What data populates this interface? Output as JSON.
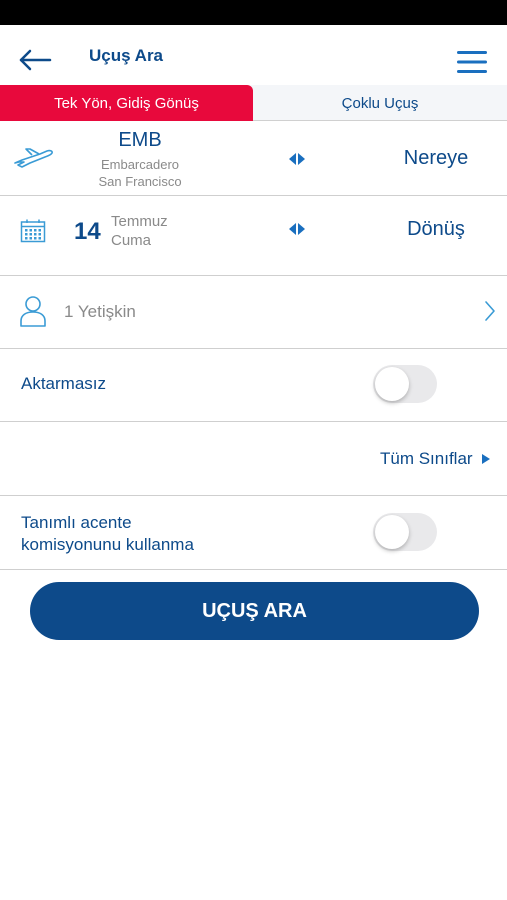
{
  "header": {
    "title": "Uçuş Ara",
    "back_icon": "arrow-left-icon",
    "menu_icon": "hamburger-menu-icon"
  },
  "tabs": [
    {
      "label": "Tek Yön, Gidiş Gönüş",
      "active": true
    },
    {
      "label": "Çoklu Uçuş",
      "active": false
    }
  ],
  "route": {
    "origin_code": "EMB",
    "origin_name": "Embarcadero",
    "origin_city": "San Francisco",
    "destination_label": "Nereye"
  },
  "date": {
    "day": "14",
    "month": "Temmuz",
    "weekday": "Cuma",
    "return_label": "Dönüş"
  },
  "passengers": {
    "label": "1 Yetişkin"
  },
  "direct": {
    "label": "Aktarmasız",
    "enabled": false
  },
  "cabin": {
    "label": "Tüm Sınıflar"
  },
  "commission": {
    "label_line1": "Tanımlı acente",
    "label_line2": "komisyonunu kullanma",
    "enabled": false
  },
  "search_button": {
    "label": "UÇUŞ ARA"
  },
  "colors": {
    "primary": "#0d4a8a",
    "accent": "#e8093c",
    "icon": "#3a9bd5",
    "muted_text": "#8a8a8a"
  }
}
